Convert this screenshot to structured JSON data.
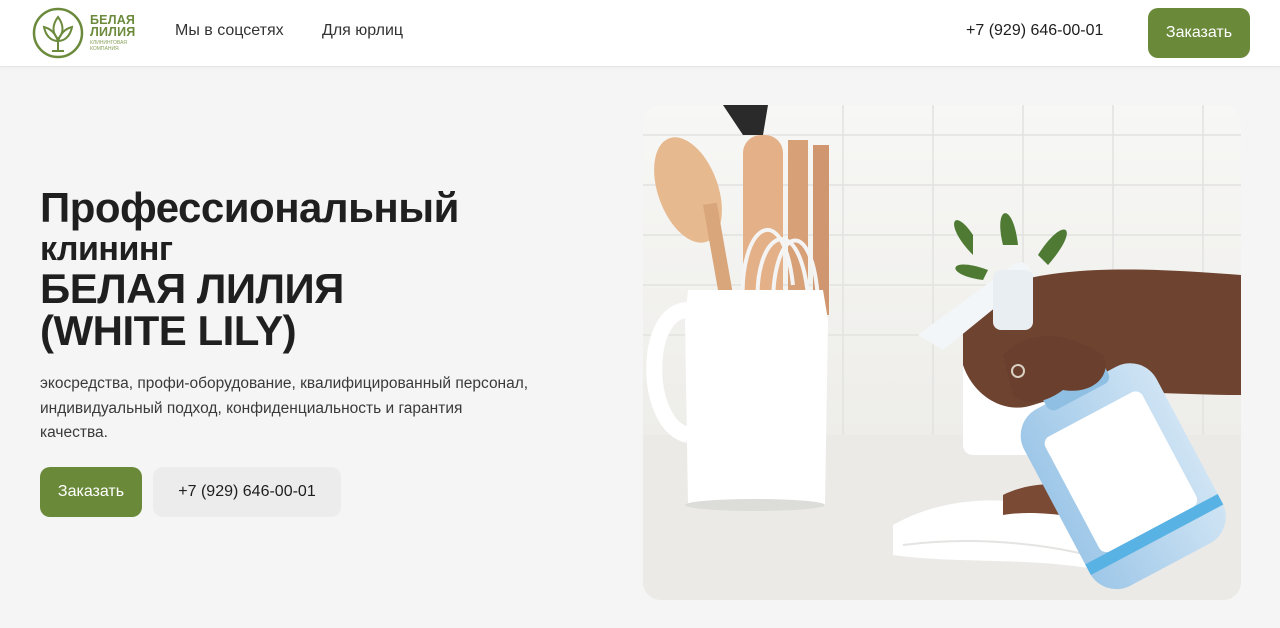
{
  "brand": {
    "name_line1": "БЕЛАЯ",
    "name_line2": "ЛИЛИЯ",
    "tagline": "клининговая компания",
    "accent_color": "#6a8a3a"
  },
  "nav": {
    "items": [
      {
        "label": "Мы в соцсетях"
      },
      {
        "label": "Для юрлиц"
      }
    ]
  },
  "header": {
    "phone": "+7 (929) 646-00-01",
    "order_label": "Заказать"
  },
  "hero": {
    "title_line1": "Профессиональный",
    "title_line2": "клининг",
    "title_line3": "БЕЛАЯ ЛИЛИЯ",
    "title_line4": "(WHITE LILY)",
    "description": "экосредства, профи-оборудование, квалифицированный персонал, индивидуальный подход, конфиденциальность и гарантия качества.",
    "order_label": "Заказать",
    "phone": "+7 (929) 646-00-01"
  },
  "photo": {
    "icon": "cleaning-photo"
  }
}
